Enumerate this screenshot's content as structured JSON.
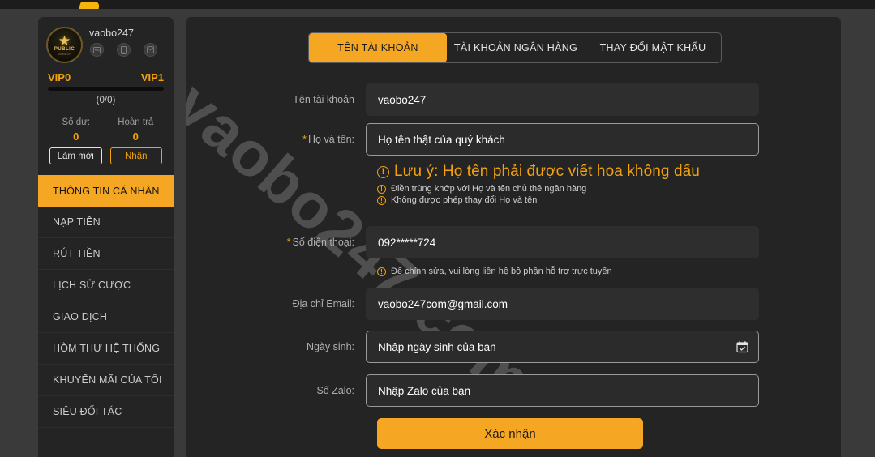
{
  "header": {
    "logo_icon": "site-logo"
  },
  "sidebar": {
    "profile": {
      "username": "vaobo247",
      "avatar_star_glyph": "★",
      "avatar_word": "PUBLIC",
      "avatar_subword": "MEMBER",
      "badges": [
        {
          "name": "id-card-badge",
          "icon": "id-card-icon"
        },
        {
          "name": "phone-badge",
          "icon": "phone-icon"
        },
        {
          "name": "email-badge",
          "icon": "email-icon"
        }
      ],
      "vip_current": "VIP0",
      "vip_next": "VIP1",
      "vip_progress_text": "(0/0)",
      "vip_progress_percent": 0,
      "stats": [
        {
          "label": "Số dư:",
          "value": "0"
        },
        {
          "label": "Hoàn trả",
          "value": "0"
        }
      ],
      "refresh_button": "Làm mới",
      "claim_button": "Nhận"
    },
    "menu": [
      {
        "label": "THÔNG TIN CÁ NHÂN",
        "active": true
      },
      {
        "label": "NẠP TIỀN",
        "active": false
      },
      {
        "label": "RÚT TIỀN",
        "active": false
      },
      {
        "label": "LỊCH SỬ CƯỢC",
        "active": false
      },
      {
        "label": "GIAO DỊCH",
        "active": false
      },
      {
        "label": "HÒM THƯ HỆ THỐNG",
        "active": false
      },
      {
        "label": "KHUYẾN MÃI CỦA TÔI",
        "active": false
      },
      {
        "label": "SIÊU ĐỐI TÁC",
        "active": false
      }
    ]
  },
  "main": {
    "watermark": "vaobo247.com",
    "tabs": [
      {
        "label": "TÊN TÀI KHOẢN",
        "active": true
      },
      {
        "label": "TÀI KHOẢN NGÂN HÀNG",
        "active": false
      },
      {
        "label": "THAY ĐỔI MẬT KHẨU",
        "active": false
      }
    ],
    "fields": {
      "username": {
        "label": "Tên tài khoản",
        "value": "vaobo247",
        "required": false,
        "readonly": true
      },
      "fullname": {
        "label": "Họ và tên:",
        "placeholder": "Họ tên thật của quý khách",
        "value": "",
        "required": true,
        "readonly": false
      },
      "phone": {
        "label": "Số điện thoại:",
        "value": "092*****724",
        "required": true,
        "readonly": true
      },
      "email": {
        "label": "Địa chỉ Email:",
        "value": "vaobo247com@gmail.com",
        "required": false,
        "readonly": true
      },
      "birthday": {
        "label": "Ngày sinh:",
        "placeholder": "Nhập ngày sinh của bạn",
        "value": "",
        "required": false,
        "readonly": false,
        "icon": "calendar-icon"
      },
      "zalo": {
        "label": "Số Zalo:",
        "placeholder": "Nhập Zalo của bạn",
        "value": "",
        "required": false,
        "readonly": false
      }
    },
    "name_notes": [
      "Lưu ý: Họ tên phải được viết hoa không dấu",
      "Điền trùng khớp với Họ và tên chủ thẻ ngân hàng",
      "Không được phép thay đổi Họ và tên"
    ],
    "phone_note": "Để chỉnh sửa, vui lòng liên hệ bộ phận hỗ trợ trực tuyến",
    "warn_glyph": "!",
    "submit_label": "Xác nhận"
  },
  "colors": {
    "accent": "#f5a623",
    "gold_text": "#f2a20c",
    "panel": "#242424",
    "page_bg": "#3a3a3a"
  }
}
